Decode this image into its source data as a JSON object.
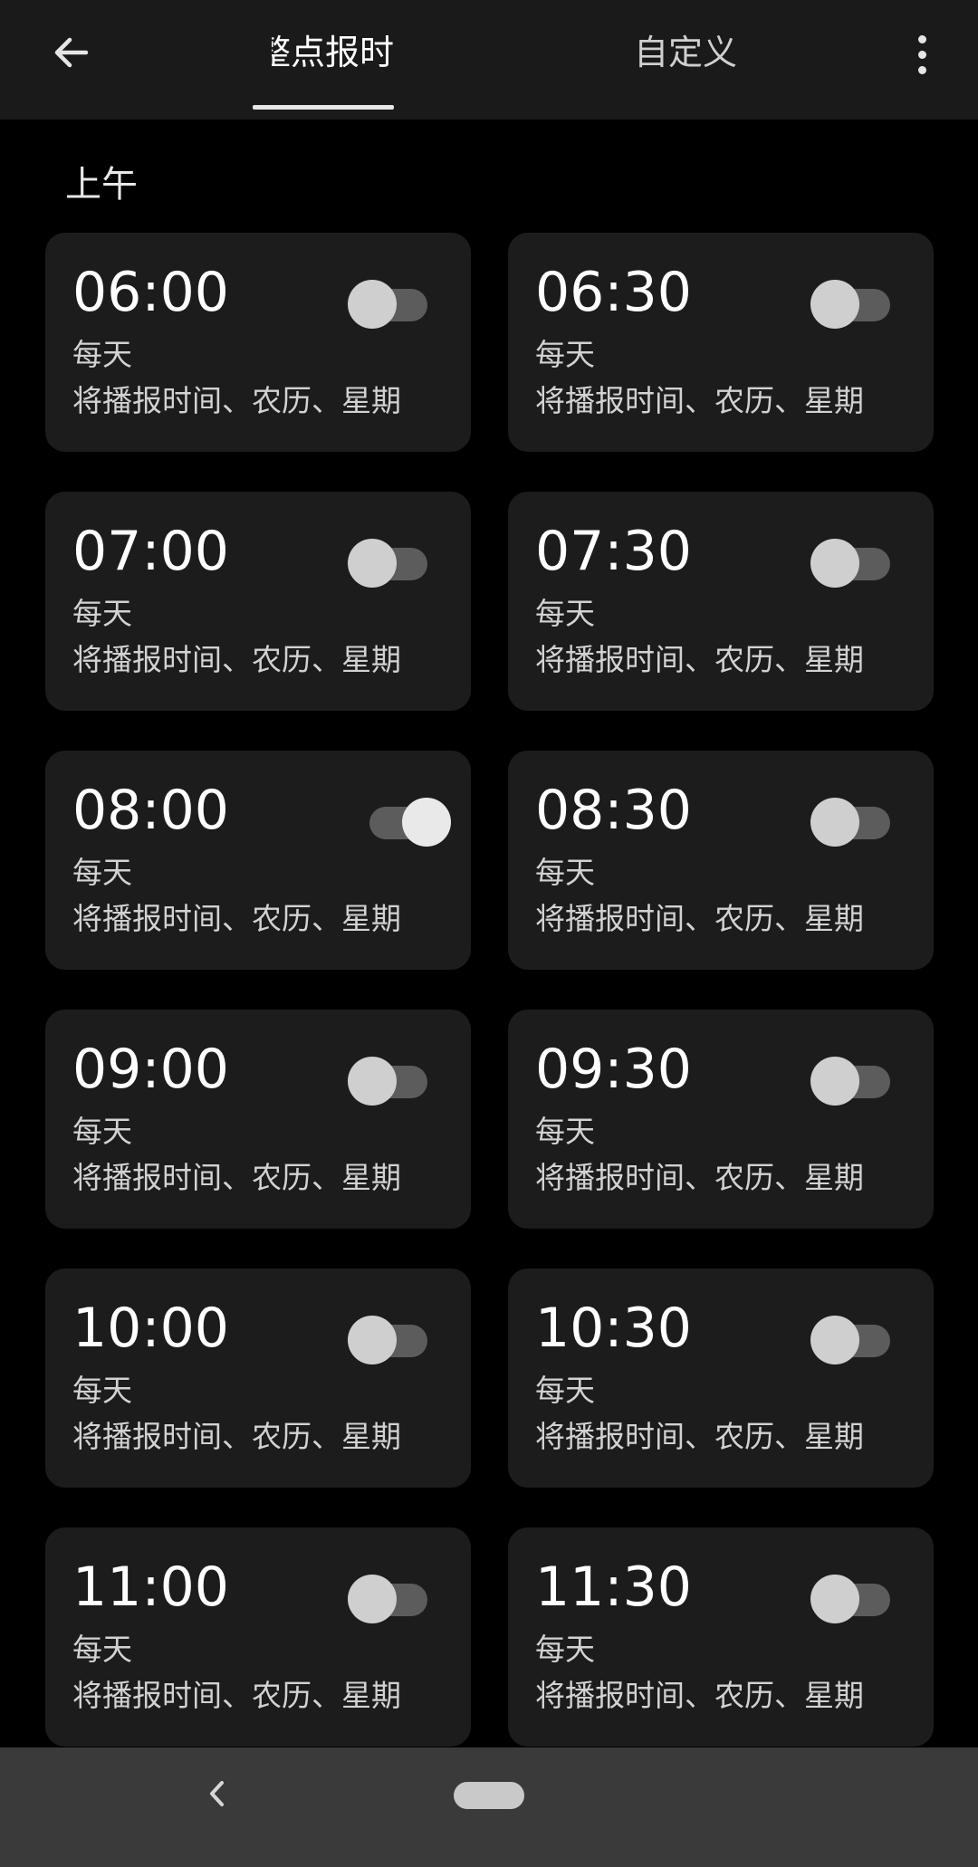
{
  "header": {
    "tabs": [
      {
        "label": "整点报时",
        "active": true
      },
      {
        "label": "自定义",
        "active": false
      }
    ]
  },
  "section": {
    "title": "上午"
  },
  "alarms": [
    {
      "time": "06:00",
      "repeat": "每天",
      "desc": "将播报时间、农历、星期",
      "enabled": false
    },
    {
      "time": "06:30",
      "repeat": "每天",
      "desc": "将播报时间、农历、星期",
      "enabled": false
    },
    {
      "time": "07:00",
      "repeat": "每天",
      "desc": "将播报时间、农历、星期",
      "enabled": false
    },
    {
      "time": "07:30",
      "repeat": "每天",
      "desc": "将播报时间、农历、星期",
      "enabled": false
    },
    {
      "time": "08:00",
      "repeat": "每天",
      "desc": "将播报时间、农历、星期",
      "enabled": true
    },
    {
      "time": "08:30",
      "repeat": "每天",
      "desc": "将播报时间、农历、星期",
      "enabled": false
    },
    {
      "time": "09:00",
      "repeat": "每天",
      "desc": "将播报时间、农历、星期",
      "enabled": false
    },
    {
      "time": "09:30",
      "repeat": "每天",
      "desc": "将播报时间、农历、星期",
      "enabled": false
    },
    {
      "time": "10:00",
      "repeat": "每天",
      "desc": "将播报时间、农历、星期",
      "enabled": false
    },
    {
      "time": "10:30",
      "repeat": "每天",
      "desc": "将播报时间、农历、星期",
      "enabled": false
    },
    {
      "time": "11:00",
      "repeat": "每天",
      "desc": "将播报时间、农历、星期",
      "enabled": false
    },
    {
      "time": "11:30",
      "repeat": "每天",
      "desc": "将播报时间、农历、星期",
      "enabled": false
    }
  ],
  "icons": {
    "back": "arrow-left-icon",
    "more": "more-vertical-icon",
    "nav_back": "chevron-left-icon",
    "nav_home": "home-pill-icon"
  }
}
